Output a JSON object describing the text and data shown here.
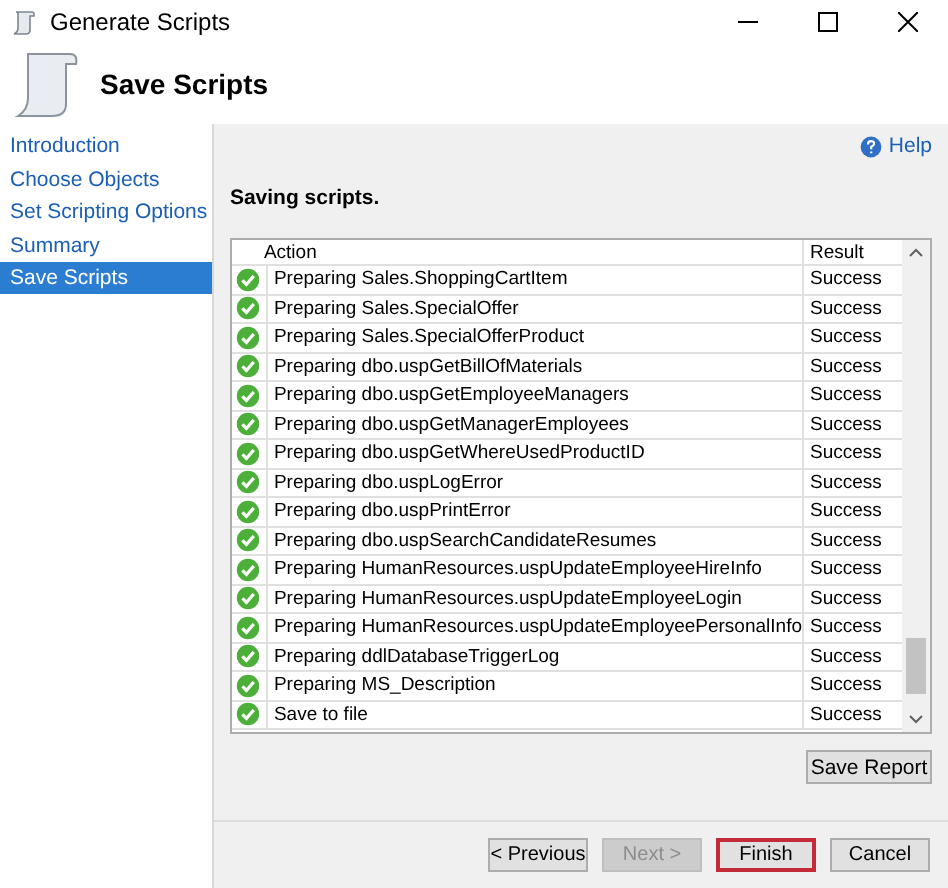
{
  "window": {
    "title": "Generate Scripts"
  },
  "header": {
    "title": "Save Scripts"
  },
  "sidebar": {
    "items": [
      {
        "label": "Introduction",
        "selected": false
      },
      {
        "label": "Choose Objects",
        "selected": false
      },
      {
        "label": "Set Scripting Options",
        "selected": false
      },
      {
        "label": "Summary",
        "selected": false
      },
      {
        "label": "Save Scripts",
        "selected": true
      }
    ]
  },
  "help": {
    "label": "Help"
  },
  "status_text": "Saving scripts.",
  "table": {
    "columns": [
      "Action",
      "Result"
    ],
    "rows": [
      {
        "action": "Preparing Sales.ShoppingCartItem",
        "result": "Success"
      },
      {
        "action": "Preparing Sales.SpecialOffer",
        "result": "Success"
      },
      {
        "action": "Preparing Sales.SpecialOfferProduct",
        "result": "Success"
      },
      {
        "action": "Preparing dbo.uspGetBillOfMaterials",
        "result": "Success"
      },
      {
        "action": "Preparing dbo.uspGetEmployeeManagers",
        "result": "Success"
      },
      {
        "action": "Preparing dbo.uspGetManagerEmployees",
        "result": "Success"
      },
      {
        "action": "Preparing dbo.uspGetWhereUsedProductID",
        "result": "Success"
      },
      {
        "action": "Preparing dbo.uspLogError",
        "result": "Success"
      },
      {
        "action": "Preparing dbo.uspPrintError",
        "result": "Success"
      },
      {
        "action": "Preparing dbo.uspSearchCandidateResumes",
        "result": "Success"
      },
      {
        "action": "Preparing HumanResources.uspUpdateEmployeeHireInfo",
        "result": "Success"
      },
      {
        "action": "Preparing HumanResources.uspUpdateEmployeeLogin",
        "result": "Success"
      },
      {
        "action": "Preparing HumanResources.uspUpdateEmployeePersonalInfo",
        "result": "Success"
      },
      {
        "action": "Preparing ddlDatabaseTriggerLog",
        "result": "Success"
      },
      {
        "action": "Preparing MS_Description",
        "result": "Success"
      },
      {
        "action": "Save to file",
        "result": "Success"
      }
    ]
  },
  "save_report": {
    "label": "Save Report"
  },
  "buttons": [
    {
      "label": "< Previous",
      "disabled": false,
      "focused": false
    },
    {
      "label": "Next >",
      "disabled": true,
      "focused": false
    },
    {
      "label": "Finish",
      "disabled": false,
      "focused": true
    },
    {
      "label": "Cancel",
      "disabled": false,
      "focused": false
    }
  ]
}
